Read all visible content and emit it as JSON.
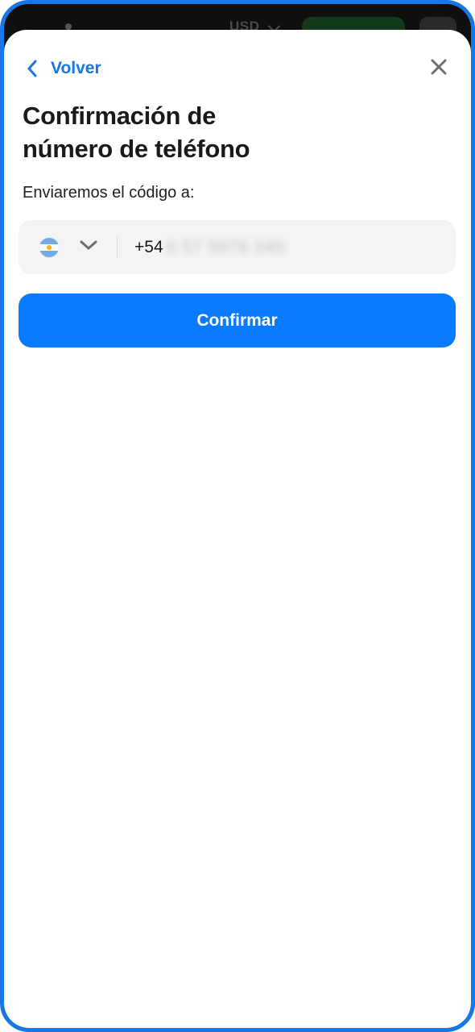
{
  "underlay": {
    "currency": "USD"
  },
  "modal": {
    "back_label": "Volver",
    "title_line1": "Confirmación de",
    "title_line2": "número de teléfono",
    "subtitle": "Enviaremos el código a:",
    "phone": {
      "country_flag": "argentina-flag-icon",
      "prefix": "+54",
      "number_masked": "0 57 5876 340"
    },
    "confirm_label": "Confirmar"
  },
  "colors": {
    "accent": "#0a7bff",
    "back_link": "#1677e6",
    "frame": "#1677e6",
    "field_bg": "#f4f4f5",
    "title": "#1a1a1a"
  }
}
